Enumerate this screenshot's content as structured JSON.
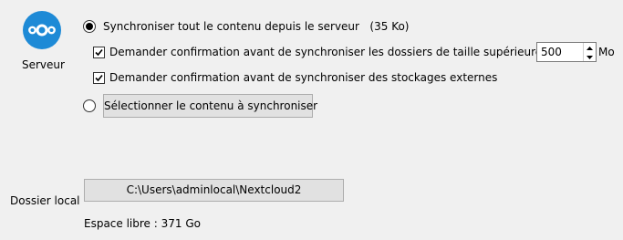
{
  "server": {
    "label": "Serveur",
    "icon": "nextcloud-logo-icon",
    "icon_color": "#1e8ad6"
  },
  "sync_options": {
    "sync_all": {
      "label": "Synchroniser tout le contenu depuis le serveur",
      "size": "(35 Ko)",
      "selected": true
    },
    "confirm_large": {
      "label": "Demander confirmation avant de synchroniser les dossiers de taille supérieure à",
      "checked": true,
      "value": "500",
      "unit": "Mo"
    },
    "confirm_external": {
      "label": "Demander confirmation avant de synchroniser des stockages externes",
      "checked": true
    },
    "select_content": {
      "selected": false,
      "button_label": "Sélectionner le contenu à synchroniser"
    }
  },
  "local_folder": {
    "label": "Dossier local",
    "path": "C:\\Users\\adminlocal\\Nextcloud2",
    "free_space": "Espace libre : 371 Go"
  }
}
